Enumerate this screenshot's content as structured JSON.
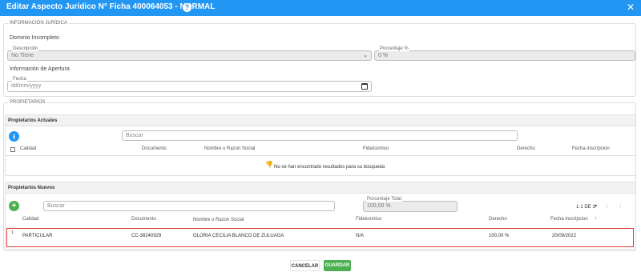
{
  "dialog": {
    "title": "Editar Aspecto Jurídico N° Ficha 400064053 - NORMAL",
    "help_icon": "question-icon",
    "close_icon": "close-icon"
  },
  "legal_info": {
    "legend": "INFORMACIÓN JURÍDICA",
    "domain_heading": "Dominio Incompleto",
    "descripcion_label": "Descripción",
    "descripcion_value": "No Tiene",
    "porcentaje_label": "Porcentaje %",
    "porcentaje_placeholder": "0 %",
    "apertura_heading": "Información de Apertura",
    "fecha_label": "Fecha",
    "fecha_placeholder": "dd/mm/yyyy"
  },
  "owners": {
    "legend": "PROPIETARIOS",
    "current": {
      "header": "Propietarios Actuales",
      "search_placeholder": "Buscar",
      "columns": [
        "Calidad",
        "Documento",
        "Nombre o Razon Social",
        "Fideicomiso",
        "Derecho",
        "Fecha inscripcion"
      ],
      "empty_message": "No se han encontrado resultados para su búsqueda"
    },
    "new": {
      "header": "Propietarios Nuevos",
      "search_placeholder": "Buscar",
      "porcentaje_total_label": "Porcentaje Total",
      "porcentaje_total_value": "100,00 %",
      "pagination": "1-1 DE 1",
      "columns": [
        "Calidad",
        "Documento",
        "Nombre o Razon Social",
        "Fideicomiso",
        "Derecho",
        "Fecha inscripcion"
      ],
      "rows": [
        {
          "index": "1",
          "calidad": "PARTICULAR",
          "documento": "CC-38240929",
          "nombre": "GLORIA CECILIA BLANCO DE ZULUAGA",
          "fideicomiso": "N/A",
          "derecho": "100,00 %",
          "fecha": "20/09/2022"
        }
      ]
    }
  },
  "footer": {
    "cancel_label": "CANCELAR",
    "save_label": "GUARDAR"
  },
  "colors": {
    "titlebar": "#2196f3",
    "accent_blue": "#2196f3",
    "accent_green": "#4caf50",
    "highlight_border": "#e53935"
  }
}
